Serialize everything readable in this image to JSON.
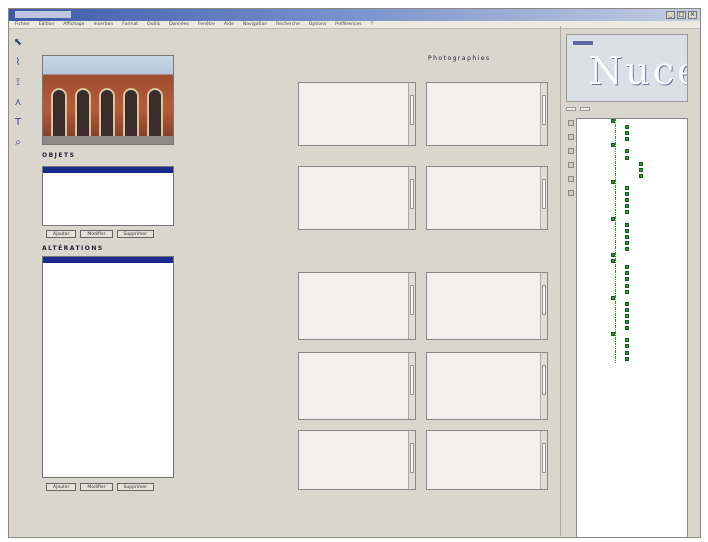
{
  "window": {
    "title": "",
    "controls": [
      "_",
      "□",
      "×"
    ]
  },
  "menu": [
    "Fichier",
    "Edition",
    "Affichage",
    "Insertion",
    "Format",
    "Outils",
    "Données",
    "Fenêtre",
    "Aide",
    "Navigation",
    "Recherche",
    "Options",
    "Préférences",
    "?"
  ],
  "breadcrumb": "",
  "left": {
    "photo_alt": "",
    "objets_label": "OBJETS",
    "objets_items": [
      {
        "text": "",
        "selected": true
      },
      {
        "text": "",
        "selected": false
      }
    ],
    "objets_buttons": [
      "Ajouter",
      "Modifier",
      "Supprimer"
    ],
    "alterations_label": "ALTÉRATIONS",
    "alterations_items": [
      {
        "text": "",
        "selected": true
      },
      {
        "text": "",
        "selected": false
      }
    ],
    "alterations_buttons": [
      "Ajouter",
      "Modifier",
      "Supprimer"
    ]
  },
  "fields_top": [
    {
      "label": "",
      "value": ""
    },
    {
      "label": "",
      "value": ""
    },
    {
      "label": "",
      "value": ""
    },
    {
      "label": "",
      "value": ""
    },
    {
      "label": "",
      "value": ""
    },
    {
      "label": "",
      "value": ""
    },
    {
      "label": "",
      "value": ""
    }
  ],
  "fields_bottom": [
    {
      "label": "",
      "value": ""
    },
    {
      "label": "",
      "value": ""
    },
    {
      "label": "",
      "value": ""
    },
    {
      "label": "",
      "value": ""
    },
    {
      "label": "",
      "value": ""
    },
    {
      "label": "",
      "value": ""
    },
    {
      "label": "",
      "value": ""
    },
    {
      "label": "",
      "value": ""
    }
  ],
  "headings": {
    "h1": "",
    "h2": "Photographies",
    "h3": ""
  },
  "boxes_top": [
    {
      "title": "",
      "lines": []
    },
    {
      "title": "",
      "lines": []
    },
    {
      "title": "",
      "lines": []
    },
    {
      "title": "",
      "lines": []
    }
  ],
  "boxes_bottom": [
    {
      "title": "",
      "lines": []
    },
    {
      "title": "",
      "lines": []
    },
    {
      "title": "",
      "lines": []
    },
    {
      "title": "",
      "lines": []
    },
    {
      "title": "",
      "lines": []
    },
    {
      "title": "",
      "lines": []
    }
  ],
  "logo": "Nuces",
  "tabs": [
    "",
    ""
  ],
  "tree": [
    {
      "num": "",
      "label": "",
      "indent": 0
    },
    {
      "num": "",
      "label": "",
      "indent": 1
    },
    {
      "num": "",
      "label": "",
      "indent": 1
    },
    {
      "num": "",
      "label": "",
      "indent": 1
    },
    {
      "num": "",
      "label": "",
      "indent": 0
    },
    {
      "num": "",
      "label": "",
      "indent": 1
    },
    {
      "num": "",
      "label": "",
      "indent": 1
    },
    {
      "num": "",
      "label": "",
      "indent": 2
    },
    {
      "num": "",
      "label": "",
      "indent": 2
    },
    {
      "num": "",
      "label": "",
      "indent": 2
    },
    {
      "num": "",
      "label": "",
      "indent": 0
    },
    {
      "num": "",
      "label": "",
      "indent": 1
    },
    {
      "num": "",
      "label": "",
      "indent": 1
    },
    {
      "num": "",
      "label": "",
      "indent": 1
    },
    {
      "num": "",
      "label": "",
      "indent": 1
    },
    {
      "num": "",
      "label": "",
      "indent": 1
    },
    {
      "num": "",
      "label": "",
      "indent": 0
    },
    {
      "num": "",
      "label": "",
      "indent": 1
    },
    {
      "num": "",
      "label": "",
      "indent": 1
    },
    {
      "num": "",
      "label": "",
      "indent": 1
    },
    {
      "num": "",
      "label": "",
      "indent": 1
    },
    {
      "num": "",
      "label": "",
      "indent": 1
    },
    {
      "num": "",
      "label": "",
      "indent": 0
    },
    {
      "num": "",
      "label": "",
      "indent": 0
    },
    {
      "num": "",
      "label": "",
      "indent": 1
    },
    {
      "num": "",
      "label": "",
      "indent": 1
    },
    {
      "num": "",
      "label": "",
      "indent": 1
    },
    {
      "num": "",
      "label": "",
      "indent": 1
    },
    {
      "num": "",
      "label": "",
      "indent": 1
    },
    {
      "num": "",
      "label": "",
      "indent": 0
    },
    {
      "num": "",
      "label": "",
      "indent": 1
    },
    {
      "num": "",
      "label": "",
      "indent": 1
    },
    {
      "num": "",
      "label": "",
      "indent": 1
    },
    {
      "num": "",
      "label": "",
      "indent": 1
    },
    {
      "num": "",
      "label": "",
      "indent": 1
    },
    {
      "num": "",
      "label": "",
      "indent": 0
    },
    {
      "num": "",
      "label": "",
      "indent": 1
    },
    {
      "num": "",
      "label": "",
      "indent": 1
    },
    {
      "num": "",
      "label": "",
      "indent": 1
    },
    {
      "num": "",
      "label": "",
      "indent": 1
    }
  ],
  "colors": {
    "selection": "#1a2a8a",
    "tree_icon": "#2a9a2a",
    "titlebar": "#3c5aa8"
  }
}
